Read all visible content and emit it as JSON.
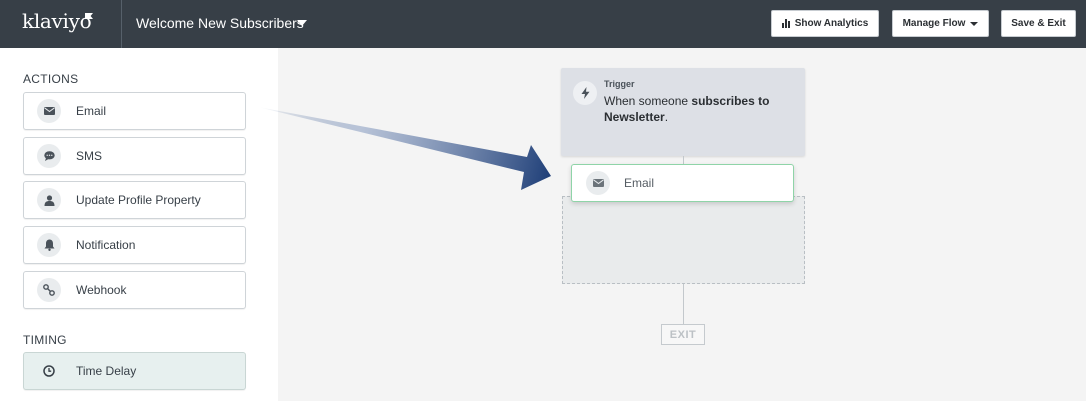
{
  "header": {
    "logo": "klaviyo",
    "flow_title": "Welcome New Subscribers",
    "show_analytics": "Show Analytics",
    "manage_flow": "Manage Flow",
    "save_exit": "Save & Exit"
  },
  "sidebar": {
    "actions_title": "ACTIONS",
    "actions": [
      {
        "label": "Email",
        "icon": "envelope-icon"
      },
      {
        "label": "SMS",
        "icon": "chat-bubble-icon"
      },
      {
        "label": "Update Profile Property",
        "icon": "person-icon"
      },
      {
        "label": "Notification",
        "icon": "bell-icon"
      },
      {
        "label": "Webhook",
        "icon": "webhook-icon"
      }
    ],
    "timing_title": "TIMING",
    "timing": [
      {
        "label": "Time Delay",
        "icon": "clock-icon"
      }
    ]
  },
  "canvas": {
    "trigger": {
      "label": "Trigger",
      "text_prefix": "When someone ",
      "text_bold": "subscribes to Newsletter",
      "text_suffix": "."
    },
    "dragged_node": {
      "label": "Email",
      "icon": "envelope-icon"
    },
    "exit_label": "EXIT"
  },
  "colors": {
    "topbar": "#373f47",
    "accent_green": "#8fd4a8",
    "arrow_blue": "#2e4f86"
  }
}
